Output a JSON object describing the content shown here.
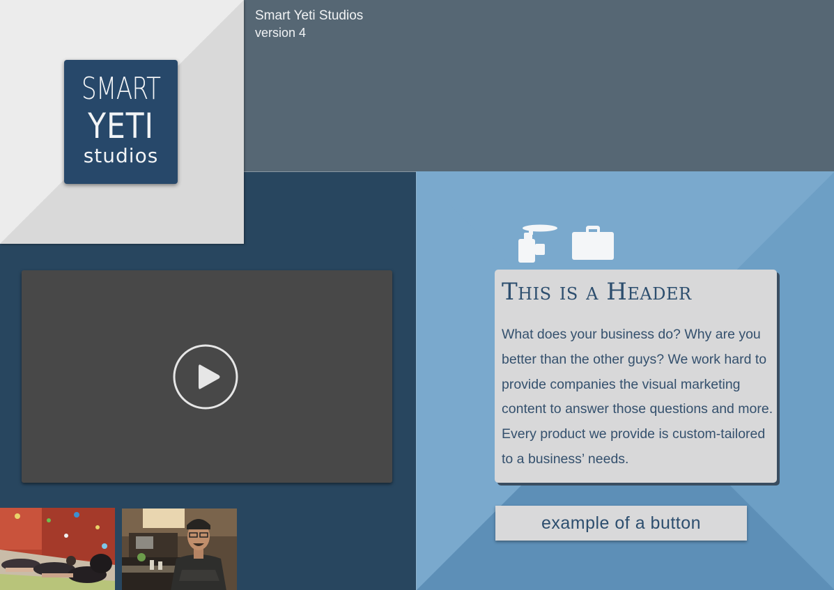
{
  "brand": {
    "logo_text": [
      "SMART",
      "YETI",
      "studios"
    ],
    "logo_color": "#27486a"
  },
  "header": {
    "studio_name": "Smart Yeti Studios",
    "version": "version 4"
  },
  "video": {
    "control_icon": "play-icon"
  },
  "thumbnails": [
    {
      "subject": "yoga-class-photo"
    },
    {
      "subject": "chef-portrait-photo"
    }
  ],
  "feature": {
    "icons": [
      "video-camera-icon",
      "briefcase-icon"
    ],
    "title": "This is a Header",
    "body": "What does your business do? Why are you better than the other guys? We work hard to provide companies the visual marketing content to answer those questions and more. Every product we provide is custom-tailored to a business’ needs.",
    "button_label": "example of a button"
  },
  "colors": {
    "dark_navy": "#28465f",
    "slate_header": "#566774",
    "light_blue": "#7aa9cd",
    "card_gray": "#d8d8d9",
    "text_blue": "#2d4e6e"
  }
}
